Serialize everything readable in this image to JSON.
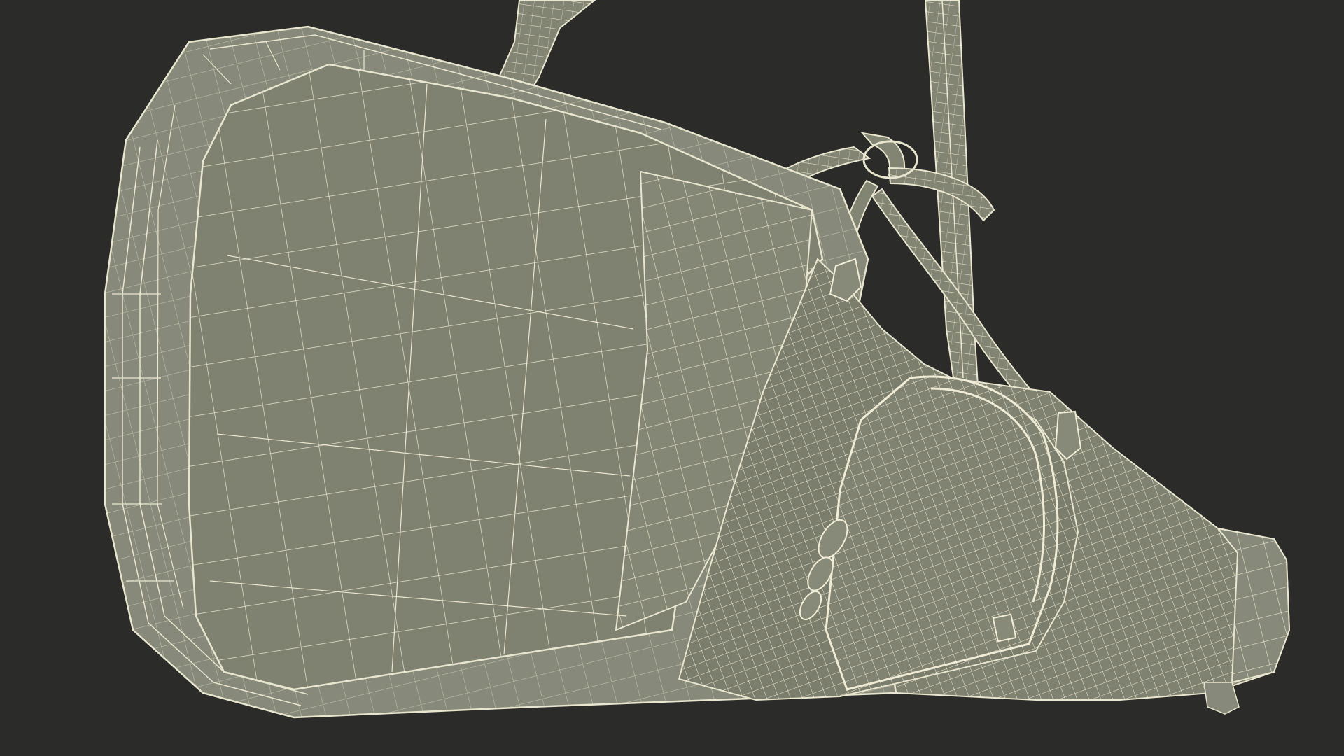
{
  "scene": {
    "subject": "guitar-case-wireframe-icon",
    "colors": {
      "background": "#2b2b29",
      "surface": "#7f8171",
      "surface_dark": "#727463",
      "surface_light": "#8b8d7c",
      "rim": "#878a7a",
      "wire": "#e9e6cf",
      "wire_dense": "#f0ecd6",
      "strap": "#838574"
    },
    "icons": [
      "case-body-icon",
      "case-rim-icon",
      "case-face-panel-icon",
      "zipper-pocket-icon",
      "zipper-pull-icon",
      "shoulder-strap-icon",
      "carry-handle-icon",
      "case-neck-icon"
    ]
  }
}
